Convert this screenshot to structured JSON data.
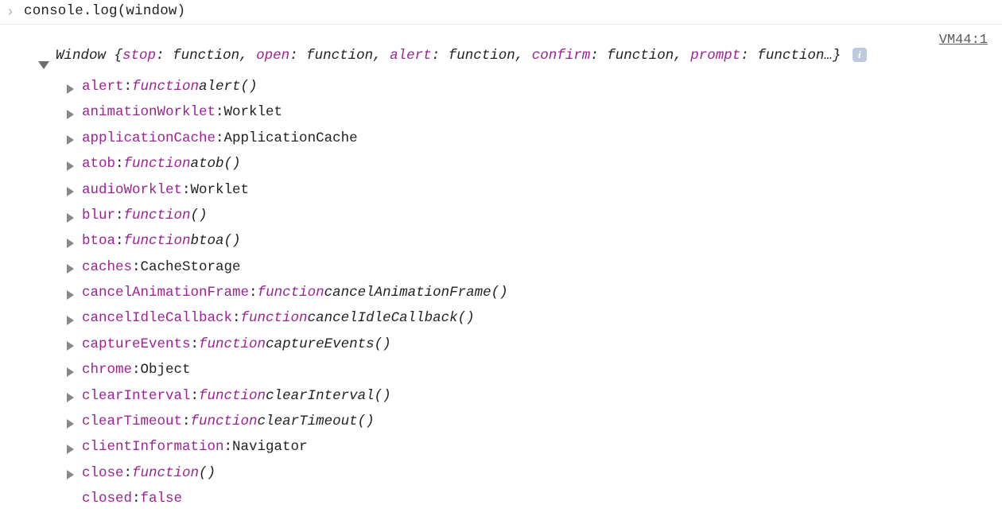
{
  "input": {
    "prompt": "›",
    "code": "console.log(window)"
  },
  "source_link": "VM44:1",
  "summary": {
    "class": "Window",
    "preview_keys": [
      "stop",
      "open",
      "alert",
      "confirm",
      "prompt"
    ],
    "preview_value": "function",
    "ellipsis": "…",
    "info_glyph": "i"
  },
  "properties": [
    {
      "key": "alert",
      "type": "function",
      "name": "alert()",
      "expandable": true
    },
    {
      "key": "animationWorklet",
      "type": "object",
      "name": "Worklet",
      "expandable": true
    },
    {
      "key": "applicationCache",
      "type": "object",
      "name": "ApplicationCache",
      "expandable": true
    },
    {
      "key": "atob",
      "type": "function",
      "name": "atob()",
      "expandable": true
    },
    {
      "key": "audioWorklet",
      "type": "object",
      "name": "Worklet",
      "expandable": true
    },
    {
      "key": "blur",
      "type": "function",
      "name": "()",
      "expandable": true
    },
    {
      "key": "btoa",
      "type": "function",
      "name": "btoa()",
      "expandable": true
    },
    {
      "key": "caches",
      "type": "object",
      "name": "CacheStorage",
      "expandable": true
    },
    {
      "key": "cancelAnimationFrame",
      "type": "function",
      "name": "cancelAnimationFrame()",
      "expandable": true
    },
    {
      "key": "cancelIdleCallback",
      "type": "function",
      "name": "cancelIdleCallback()",
      "expandable": true
    },
    {
      "key": "captureEvents",
      "type": "function",
      "name": "captureEvents()",
      "expandable": true
    },
    {
      "key": "chrome",
      "type": "object",
      "name": "Object",
      "expandable": true
    },
    {
      "key": "clearInterval",
      "type": "function",
      "name": "clearInterval()",
      "expandable": true
    },
    {
      "key": "clearTimeout",
      "type": "function",
      "name": "clearTimeout()",
      "expandable": true
    },
    {
      "key": "clientInformation",
      "type": "object",
      "name": "Navigator",
      "expandable": true
    },
    {
      "key": "close",
      "type": "function",
      "name": "()",
      "expandable": true
    },
    {
      "key": "closed",
      "type": "boolean",
      "name": "false",
      "expandable": false
    }
  ],
  "labels": {
    "function_keyword": "function"
  }
}
